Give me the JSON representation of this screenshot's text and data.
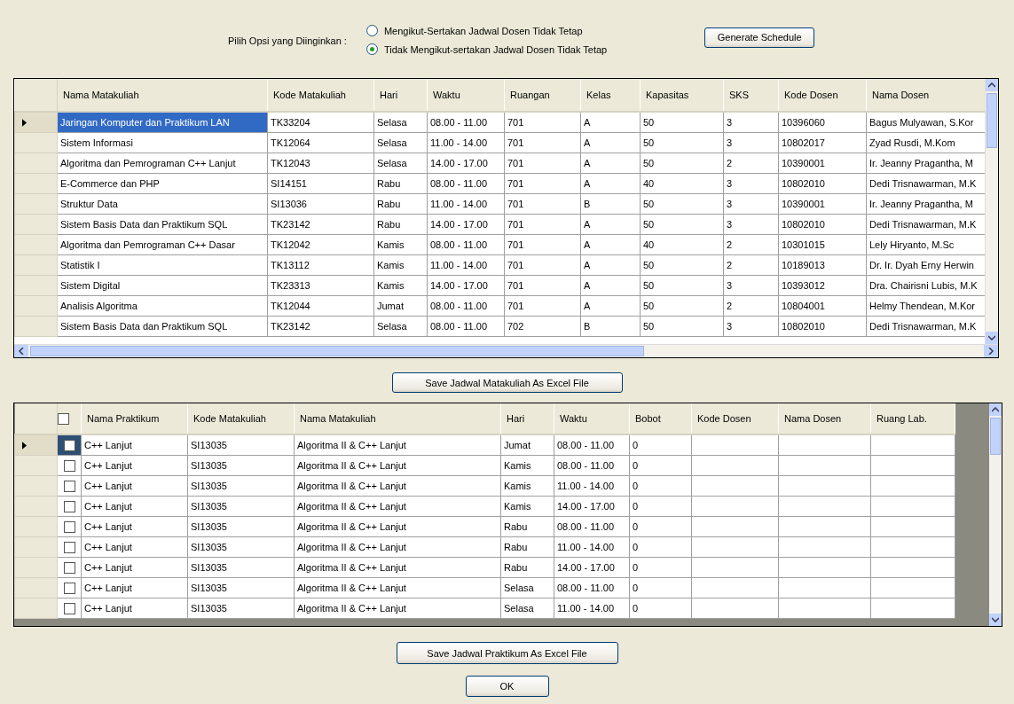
{
  "options": {
    "label": "Pilih Opsi yang Diinginkan :",
    "items": [
      {
        "label": "Mengikut-Sertakan Jadwal Dosen Tidak Tetap",
        "selected": false
      },
      {
        "label": "Tidak Mengikut-sertakan Jadwal Dosen Tidak Tetap",
        "selected": true
      }
    ]
  },
  "generate_button": "Generate Schedule",
  "course_table": {
    "columns": [
      "Nama Matakuliah",
      "Kode Matakuliah",
      "Hari",
      "Waktu",
      "Ruangan",
      "Kelas",
      "Kapasitas",
      "SKS",
      "Kode Dosen",
      "Nama Dosen"
    ],
    "rows": [
      {
        "selected": true,
        "cells": [
          "Jaringan Komputer dan Praktikum LAN",
          "TK33204",
          "Selasa",
          "08.00 - 11.00",
          "701",
          "A",
          "50",
          "3",
          "10396060",
          "Bagus Mulyawan, S.Kor"
        ]
      },
      {
        "selected": false,
        "cells": [
          "Sistem Informasi",
          "TK12064",
          "Selasa",
          "11.00 - 14.00",
          "701",
          "A",
          "50",
          "3",
          "10802017",
          "Zyad Rusdi, M.Kom"
        ]
      },
      {
        "selected": false,
        "cells": [
          "Algoritma dan Pemrograman C++ Lanjut",
          "TK12043",
          "Selasa",
          "14.00 - 17.00",
          "701",
          "A",
          "50",
          "2",
          "10390001",
          "Ir. Jeanny Pragantha, M"
        ]
      },
      {
        "selected": false,
        "cells": [
          "E-Commerce dan PHP",
          "SI14151",
          "Rabu",
          "08.00 - 11.00",
          "701",
          "A",
          "40",
          "3",
          "10802010",
          "Dedi Trisnawarman, M.K"
        ]
      },
      {
        "selected": false,
        "cells": [
          "Struktur Data",
          "SI13036",
          "Rabu",
          "11.00 - 14.00",
          "701",
          "B",
          "50",
          "3",
          "10390001",
          "Ir. Jeanny Pragantha, M"
        ]
      },
      {
        "selected": false,
        "cells": [
          "Sistem Basis Data dan Praktikum SQL",
          "TK23142",
          "Rabu",
          "14.00 - 17.00",
          "701",
          "A",
          "50",
          "3",
          "10802010",
          "Dedi Trisnawarman, M.K"
        ]
      },
      {
        "selected": false,
        "cells": [
          "Algoritma dan Pemrograman C++ Dasar",
          "TK12042",
          "Kamis",
          "08.00 - 11.00",
          "701",
          "A",
          "40",
          "2",
          "10301015",
          "Lely Hiryanto, M.Sc"
        ]
      },
      {
        "selected": false,
        "cells": [
          "Statistik I",
          "TK13112",
          "Kamis",
          "11.00 - 14.00",
          "701",
          "A",
          "50",
          "2",
          "10189013",
          "Dr. Ir. Dyah Erny Herwin"
        ]
      },
      {
        "selected": false,
        "cells": [
          "Sistem Digital",
          "TK23313",
          "Kamis",
          "14.00 - 17.00",
          "701",
          "A",
          "50",
          "3",
          "10393012",
          "Dra. Chairisni Lubis, M.K"
        ]
      },
      {
        "selected": false,
        "cells": [
          "Analisis Algoritma",
          "TK12044",
          "Jumat",
          "08.00 - 11.00",
          "701",
          "A",
          "50",
          "2",
          "10804001",
          "Helmy Thendean, M.Kor"
        ]
      },
      {
        "selected": false,
        "cells": [
          "Sistem Basis Data dan Praktikum SQL",
          "TK23142",
          "Selasa",
          "08.00 - 11.00",
          "702",
          "B",
          "50",
          "3",
          "10802010",
          "Dedi Trisnawarman, M.K"
        ]
      }
    ]
  },
  "save_course_button": "Save Jadwal Matakuliah As Excel File",
  "practicum_table": {
    "header_checked": false,
    "columns": [
      "Nama Praktikum",
      "Kode Matakuliah",
      "Nama Matakuliah",
      "Hari",
      "Waktu",
      "Bobot",
      "Kode Dosen",
      "Nama Dosen",
      "Ruang Lab."
    ],
    "rows": [
      {
        "selected": true,
        "checked": false,
        "cells": [
          "C++ Lanjut",
          "SI13035",
          "Algoritma II & C++ Lanjut",
          "Jumat",
          "08.00 - 11.00",
          "0"
        ]
      },
      {
        "selected": false,
        "checked": false,
        "cells": [
          "C++ Lanjut",
          "SI13035",
          "Algoritma II & C++ Lanjut",
          "Kamis",
          "08.00 - 11.00",
          "0"
        ]
      },
      {
        "selected": false,
        "checked": false,
        "cells": [
          "C++ Lanjut",
          "SI13035",
          "Algoritma II & C++ Lanjut",
          "Kamis",
          "11.00 - 14.00",
          "0"
        ]
      },
      {
        "selected": false,
        "checked": false,
        "cells": [
          "C++ Lanjut",
          "SI13035",
          "Algoritma II & C++ Lanjut",
          "Kamis",
          "14.00 - 17.00",
          "0"
        ]
      },
      {
        "selected": false,
        "checked": false,
        "cells": [
          "C++ Lanjut",
          "SI13035",
          "Algoritma II & C++ Lanjut",
          "Rabu",
          "08.00 - 11.00",
          "0"
        ]
      },
      {
        "selected": false,
        "checked": false,
        "cells": [
          "C++ Lanjut",
          "SI13035",
          "Algoritma II & C++ Lanjut",
          "Rabu",
          "11.00 - 14.00",
          "0"
        ]
      },
      {
        "selected": false,
        "checked": false,
        "cells": [
          "C++ Lanjut",
          "SI13035",
          "Algoritma II & C++ Lanjut",
          "Rabu",
          "14.00 - 17.00",
          "0"
        ]
      },
      {
        "selected": false,
        "checked": false,
        "cells": [
          "C++ Lanjut",
          "SI13035",
          "Algoritma II & C++ Lanjut",
          "Selasa",
          "08.00 - 11.00",
          "0"
        ]
      },
      {
        "selected": false,
        "checked": false,
        "cells": [
          "C++ Lanjut",
          "SI13035",
          "Algoritma II & C++ Lanjut",
          "Selasa",
          "11.00 - 14.00",
          "0"
        ]
      }
    ]
  },
  "save_practicum_button": "Save Jadwal Praktikum As Excel File",
  "ok_button": "OK"
}
